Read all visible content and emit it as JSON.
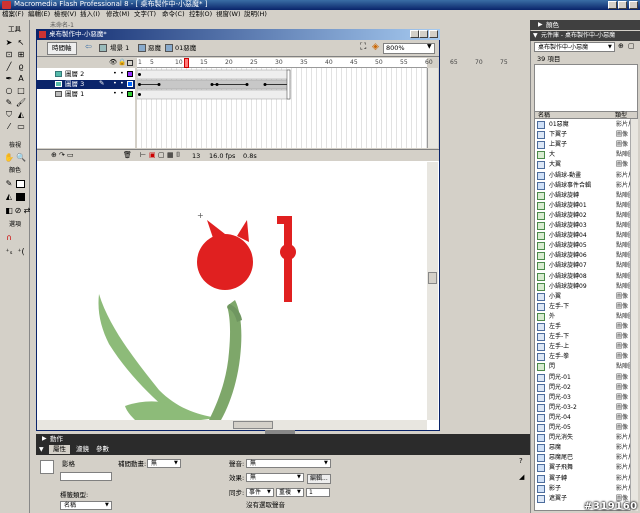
{
  "app": {
    "title": "Macromedia Flash Professional 8 - [ 桌布製作中-小惡魔* ]"
  },
  "menu": [
    "檔案(F)",
    "編輯(E)",
    "檢視(V)",
    "插入(I)",
    "修改(M)",
    "文字(T)",
    "命令(C)",
    "控制(O)",
    "視窗(W)",
    "說明(H)"
  ],
  "tools": {
    "title": "工具",
    "view_label": "檢視",
    "colors_label": "顏色",
    "options_label": "選項"
  },
  "document": {
    "outer_tab": "未命名-1",
    "title": "桌布製作中-小惡魔*",
    "timeline_button": "時間軸",
    "breadcrumb": [
      "場景 1",
      "惡魔",
      "01惡魔"
    ],
    "zoom": "800%"
  },
  "timeline": {
    "layers": [
      {
        "name": "圖層 2",
        "selected": false
      },
      {
        "name": "圖層 3",
        "selected": true
      },
      {
        "name": "圖層 1",
        "selected": false
      }
    ],
    "ruler_ticks": [
      "1",
      "5",
      "10",
      "15",
      "20",
      "25",
      "30",
      "35",
      "40",
      "45",
      "50",
      "55",
      "60",
      "65",
      "70",
      "75"
    ],
    "current_frame": "13",
    "fps": "16.0 fps",
    "elapsed": "0.8s"
  },
  "panels": {
    "color": "顏色",
    "library": "元件庫 - 桌布製作中-小惡魔",
    "library_dropdown": "桌布製作中-小惡魔",
    "item_count": "39 項目",
    "col_name": "名稱",
    "col_type": "類型",
    "items": [
      {
        "name": "01惡魔",
        "type": "影片片"
      },
      {
        "name": "下翼子",
        "type": "圖像"
      },
      {
        "name": "上翼子",
        "type": "圖像"
      },
      {
        "name": "大",
        "type": "點陣圖"
      },
      {
        "name": "大翼",
        "type": "圖像"
      },
      {
        "name": "小鍋球-動畫",
        "type": "影片片"
      },
      {
        "name": "小鍋球事件合輯",
        "type": "影片片"
      },
      {
        "name": "小鍋球旋轉",
        "type": "點陣圖"
      },
      {
        "name": "小鍋球旋轉01",
        "type": "點陣圖"
      },
      {
        "name": "小鍋球旋轉02",
        "type": "點陣圖"
      },
      {
        "name": "小鍋球旋轉03",
        "type": "點陣圖"
      },
      {
        "name": "小鍋球旋轉04",
        "type": "點陣圖"
      },
      {
        "name": "小鍋球旋轉05",
        "type": "點陣圖"
      },
      {
        "name": "小鍋球旋轉06",
        "type": "點陣圖"
      },
      {
        "name": "小鍋球旋轉07",
        "type": "點陣圖"
      },
      {
        "name": "小鍋球旋轉08",
        "type": "點陣圖"
      },
      {
        "name": "小鍋球旋轉09",
        "type": "點陣圖"
      },
      {
        "name": "小翼",
        "type": "圖像"
      },
      {
        "name": "左手-下",
        "type": "圖像"
      },
      {
        "name": "外",
        "type": "點陣圖"
      },
      {
        "name": "左手",
        "type": "圖像"
      },
      {
        "name": "左手-下",
        "type": "圖像"
      },
      {
        "name": "左手-上",
        "type": "圖像"
      },
      {
        "name": "左手-拳",
        "type": "圖像"
      },
      {
        "name": "閃",
        "type": "點陣圖"
      },
      {
        "name": "閃光-01",
        "type": "圖像"
      },
      {
        "name": "閃光-02",
        "type": "圖像"
      },
      {
        "name": "閃光-03",
        "type": "圖像"
      },
      {
        "name": "閃光-03-2",
        "type": "圖像"
      },
      {
        "name": "閃光-04",
        "type": "圖像"
      },
      {
        "name": "閃光-05",
        "type": "圖像"
      },
      {
        "name": "閃光消失",
        "type": "影片片"
      },
      {
        "name": "惡魔",
        "type": "影片片"
      },
      {
        "name": "惡魔尾巴",
        "type": "影片片"
      },
      {
        "name": "翼子飛舞",
        "type": "影片片"
      },
      {
        "name": "翼子轉",
        "type": "影片片"
      },
      {
        "name": "影子",
        "type": "影片片"
      },
      {
        "name": "遮翼子",
        "type": "圖像"
      }
    ]
  },
  "actions_panel": {
    "title": "動作"
  },
  "properties": {
    "tabs": [
      "屬性",
      "濾鏡",
      "參數"
    ],
    "frame_label": "影格",
    "tween_label": "補間動畫:",
    "tween_value": "無",
    "sound_label": "聲音:",
    "sound_value": "無",
    "effect_label": "效果:",
    "effect_value": "無",
    "edit_button": "編輯...",
    "sync_label": "同步:",
    "sync_value": "事件",
    "repeat_value": "重複",
    "repeat_count": "1",
    "no_sound": "沒有選取聲音",
    "label_type_label": "標籤類型:",
    "label_type_value": "名稱"
  },
  "watermark": "#319160"
}
